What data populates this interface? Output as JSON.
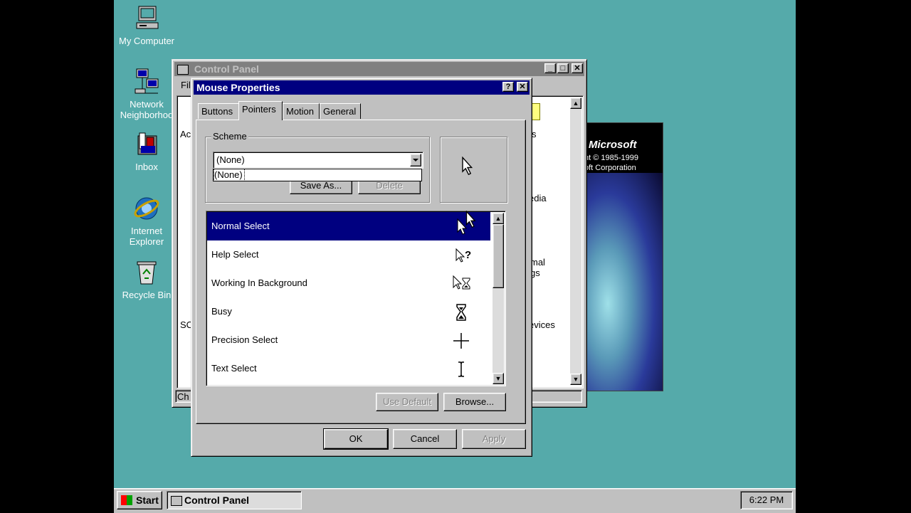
{
  "desktop": {
    "icons": [
      {
        "label": "My Computer",
        "icon": "computer-icon"
      },
      {
        "label": "Network Neighborhood",
        "icon": "network-icon"
      },
      {
        "label": "Inbox",
        "icon": "inbox-icon"
      },
      {
        "label": "Internet Explorer",
        "icon": "ie-icon"
      },
      {
        "label": "Recycle Bin",
        "icon": "recycle-bin-icon"
      }
    ]
  },
  "splash": {
    "brand": "Microsoft",
    "line1": "ht © 1985-1999",
    "line2": "oft Corporation"
  },
  "control_panel": {
    "title": "Control Panel",
    "menu_file": "Fil",
    "side_text_1": "Ac",
    "side_text_2": "SC",
    "status_text": "Ch",
    "partial_labels": [
      "s",
      "edia",
      "mal",
      "gs",
      "evices"
    ]
  },
  "mouse_properties": {
    "title": "Mouse Properties",
    "help_btn": "?",
    "close_btn": "✕",
    "tabs": [
      {
        "label": "Buttons"
      },
      {
        "label": "Pointers"
      },
      {
        "label": "Motion"
      },
      {
        "label": "General"
      }
    ],
    "scheme": {
      "group_label": "Scheme",
      "selected": "(None)",
      "dropdown_option": "(None)",
      "save_as": "Save As...",
      "delete": "Delete"
    },
    "pointers": [
      {
        "label": "Normal Select",
        "icon": "arrow-cursor-icon",
        "selected": true
      },
      {
        "label": "Help Select",
        "icon": "help-cursor-icon"
      },
      {
        "label": "Working In Background",
        "icon": "working-cursor-icon"
      },
      {
        "label": "Busy",
        "icon": "hourglass-icon"
      },
      {
        "label": "Precision Select",
        "icon": "crosshair-icon"
      },
      {
        "label": "Text Select",
        "icon": "ibeam-icon"
      }
    ],
    "use_default": "Use Default",
    "browse": "Browse...",
    "ok": "OK",
    "cancel": "Cancel",
    "apply": "Apply"
  },
  "taskbar": {
    "start": "Start",
    "task": "Control Panel",
    "clock": "6:22 PM"
  }
}
